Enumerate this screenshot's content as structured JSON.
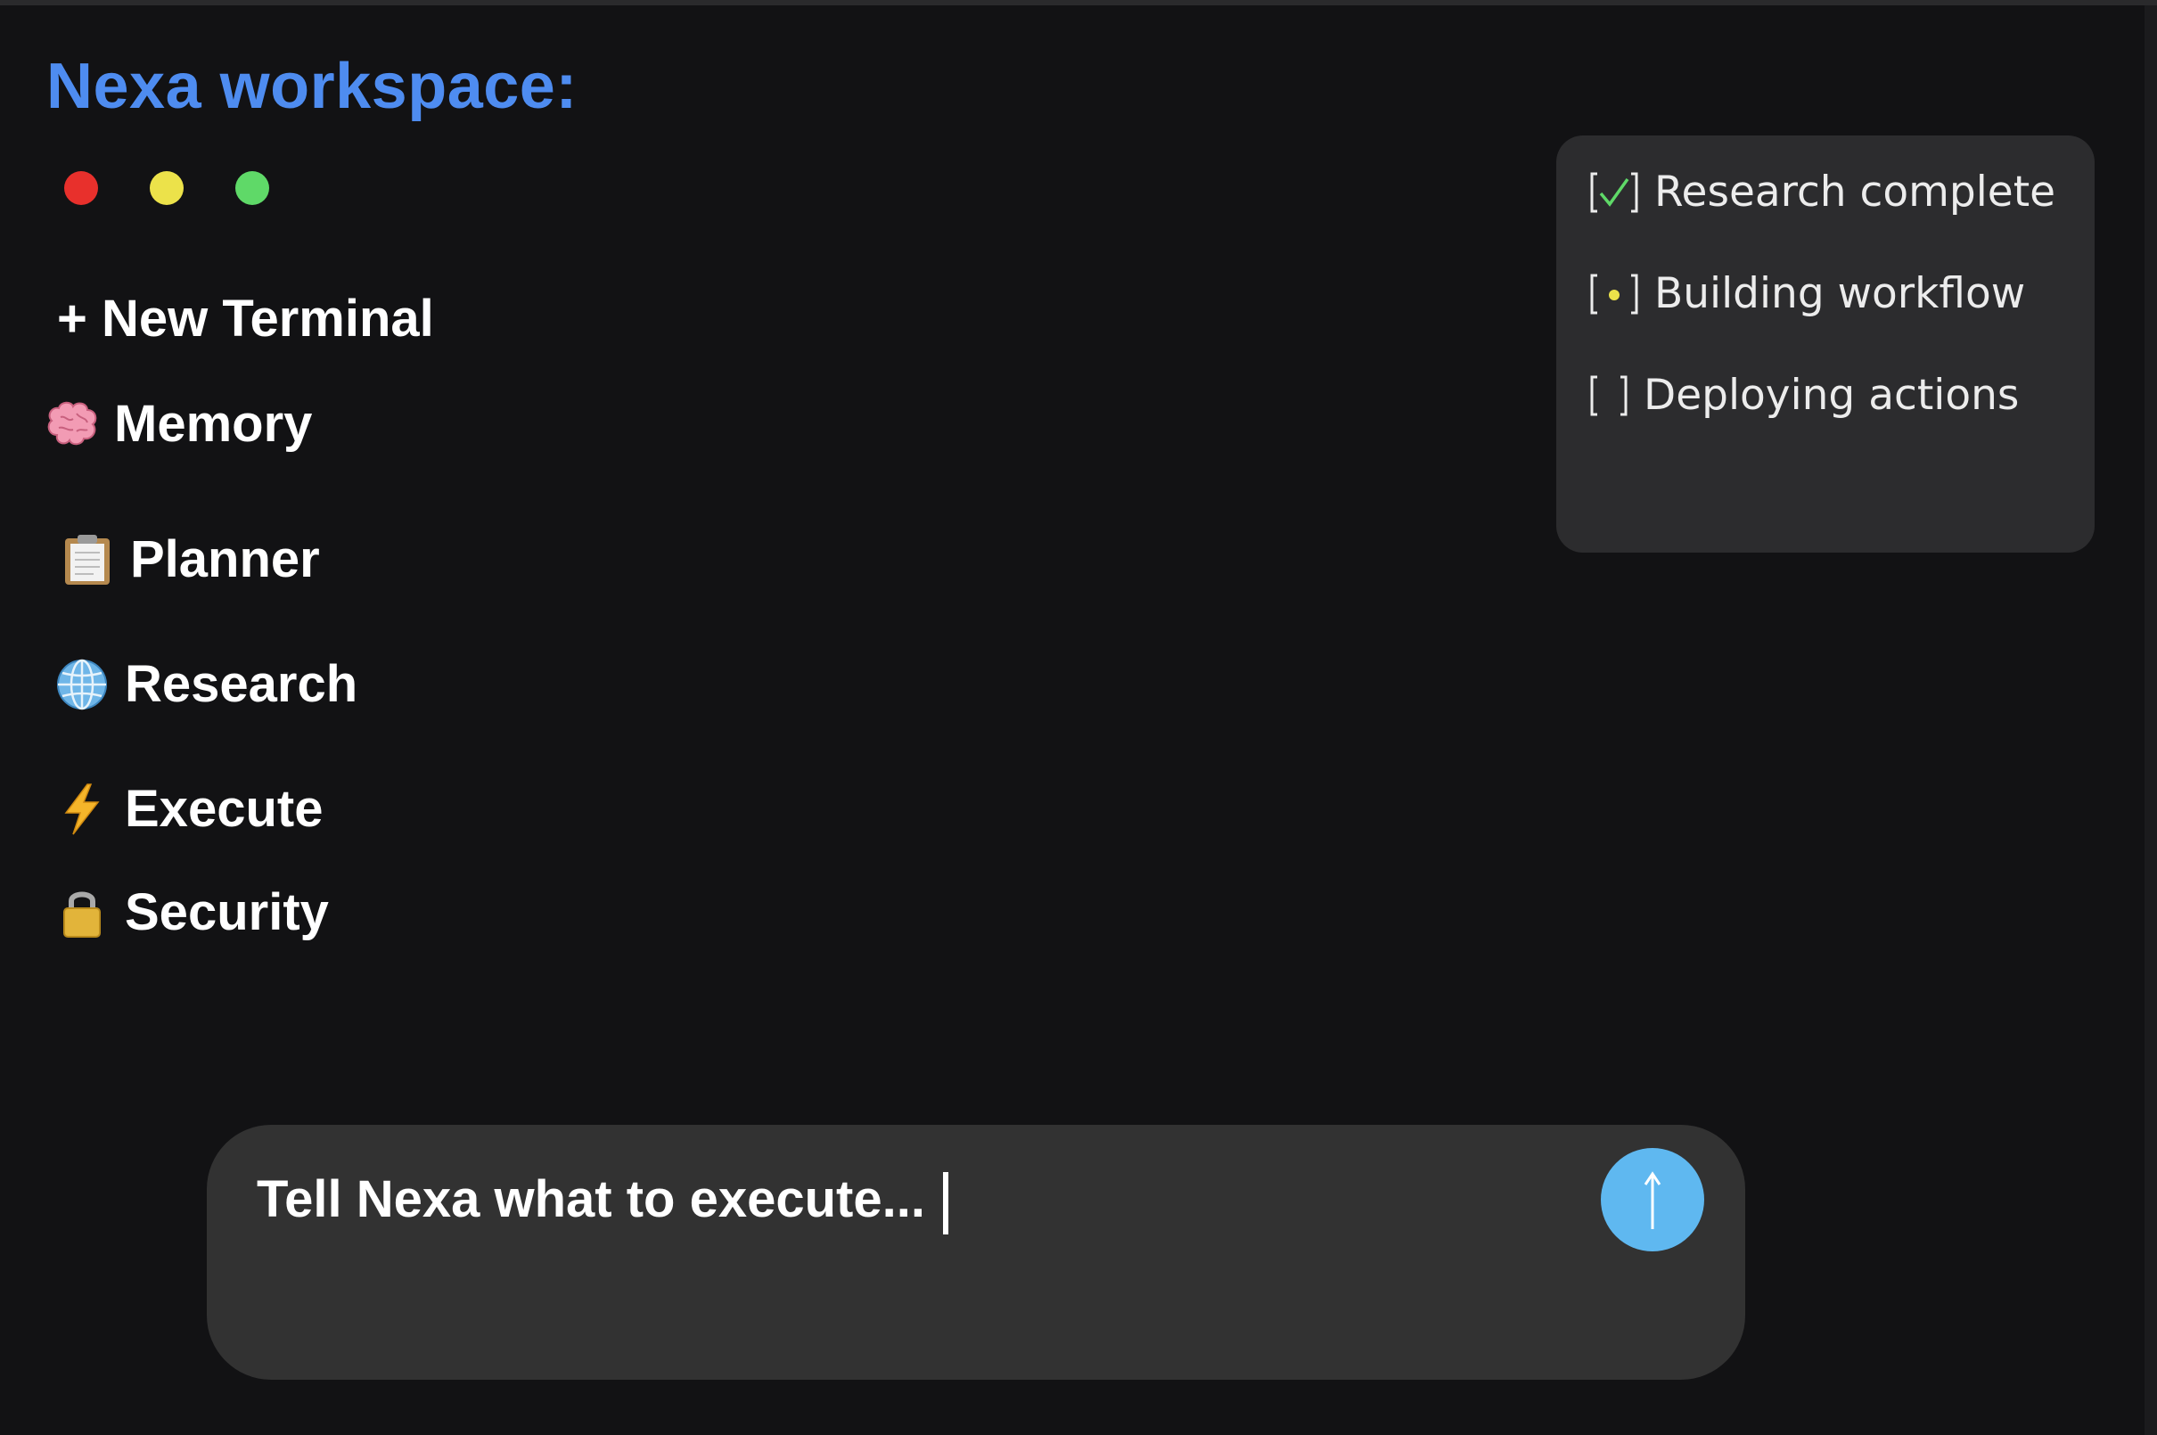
{
  "app": {
    "title": "Nexa workspace:"
  },
  "window_controls": {
    "close_color": "#e8302c",
    "minimize_color": "#ece24a",
    "maximize_color": "#5fd968"
  },
  "sidebar": {
    "items": [
      {
        "label": "+ New Terminal",
        "icon": "none"
      },
      {
        "label": "Memory",
        "icon": "brain-icon"
      },
      {
        "label": "Planner",
        "icon": "clipboard-icon"
      },
      {
        "label": "Research",
        "icon": "globe-icon"
      },
      {
        "label": "Execute",
        "icon": "lightning-icon"
      },
      {
        "label": "Security",
        "icon": "lock-icon"
      }
    ]
  },
  "status": {
    "items": [
      {
        "label": "Research complete",
        "state": "done"
      },
      {
        "label": "Building workflow",
        "state": "in-progress"
      },
      {
        "label": "Deploying actions",
        "state": "pending"
      }
    ]
  },
  "composer": {
    "placeholder": "Tell Nexa what to execute...",
    "send_icon": "arrow-up-icon",
    "send_color": "#5fb8f0"
  },
  "colors": {
    "background": "#121214",
    "accent": "#4e8cf0",
    "panel": "#2c2c2e",
    "check": "#5fd968",
    "progress_dot": "#ece24a"
  }
}
